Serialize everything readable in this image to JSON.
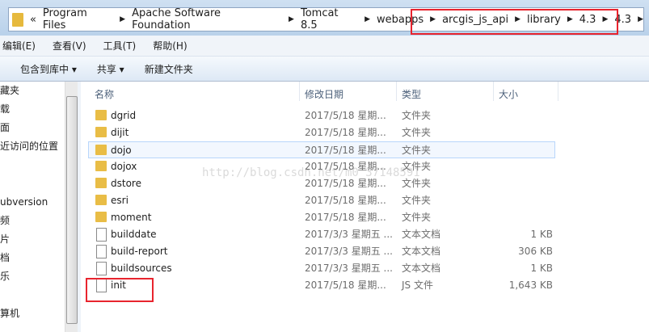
{
  "breadcrumb": [
    "Program Files",
    "Apache Software Foundation",
    "Tomcat 8.5",
    "webapps",
    "arcgis_js_api",
    "library",
    "4.3",
    "4.3"
  ],
  "menu": [
    "编辑(E)",
    "查看(V)",
    "工具(T)",
    "帮助(H)"
  ],
  "toolbar": [
    "包含到库中 ▾",
    "共享 ▾",
    "新建文件夹"
  ],
  "sidebar": [
    "藏夹",
    "载",
    "面",
    "近访问的位置",
    "",
    "",
    "ubversion",
    "频",
    "片",
    "档",
    "乐",
    "",
    "算机"
  ],
  "columns": {
    "name": "名称",
    "date": "修改日期",
    "type": "类型",
    "size": "大小"
  },
  "files": [
    {
      "name": "dgrid",
      "date": "2017/5/18 星期...",
      "type": "文件夹",
      "size": "",
      "kind": "folder"
    },
    {
      "name": "dijit",
      "date": "2017/5/18 星期...",
      "type": "文件夹",
      "size": "",
      "kind": "folder"
    },
    {
      "name": "dojo",
      "date": "2017/5/18 星期...",
      "type": "文件夹",
      "size": "",
      "kind": "folder"
    },
    {
      "name": "dojox",
      "date": "2017/5/18 星期...",
      "type": "文件夹",
      "size": "",
      "kind": "folder"
    },
    {
      "name": "dstore",
      "date": "2017/5/18 星期...",
      "type": "文件夹",
      "size": "",
      "kind": "folder"
    },
    {
      "name": "esri",
      "date": "2017/5/18 星期...",
      "type": "文件夹",
      "size": "",
      "kind": "folder"
    },
    {
      "name": "moment",
      "date": "2017/5/18 星期...",
      "type": "文件夹",
      "size": "",
      "kind": "folder"
    },
    {
      "name": "builddate",
      "date": "2017/3/3 星期五 ...",
      "type": "文本文档",
      "size": "1 KB",
      "kind": "doc"
    },
    {
      "name": "build-report",
      "date": "2017/3/3 星期五 ...",
      "type": "文本文档",
      "size": "306 KB",
      "kind": "doc"
    },
    {
      "name": "buildsources",
      "date": "2017/3/3 星期五 ...",
      "type": "文本文档",
      "size": "1 KB",
      "kind": "doc"
    },
    {
      "name": "init",
      "date": "2017/5/18 星期...",
      "type": "JS 文件",
      "size": "1,643 KB",
      "kind": "doc"
    }
  ],
  "watermark": "http://blog.csdn.net/m0_37148591"
}
